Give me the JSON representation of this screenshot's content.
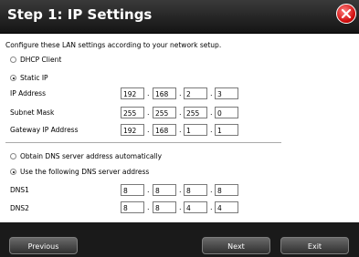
{
  "title": "Step 1: IP Settings",
  "instructions": "Configure these LAN settings according to your network setup.",
  "options": {
    "dhcp": "DHCP Client",
    "static": "Static IP"
  },
  "labels": {
    "ip": "IP Address",
    "mask": "Subnet Mask",
    "gateway": "Gateway IP Address"
  },
  "ip": [
    "192",
    "168",
    "2",
    "3"
  ],
  "mask": [
    "255",
    "255",
    "255",
    "0"
  ],
  "gateway": [
    "192",
    "168",
    "1",
    "1"
  ],
  "dns_options": {
    "auto": "Obtain DNS server address automatically",
    "manual": "Use the following DNS server address"
  },
  "dns_labels": {
    "dns1": "DNS1",
    "dns2": "DNS2"
  },
  "dns1": [
    "8",
    "8",
    "8",
    "8"
  ],
  "dns2": [
    "8",
    "8",
    "4",
    "4"
  ],
  "buttons": {
    "previous": "Previous",
    "next": "Next",
    "exit": "Exit"
  },
  "separator": "."
}
